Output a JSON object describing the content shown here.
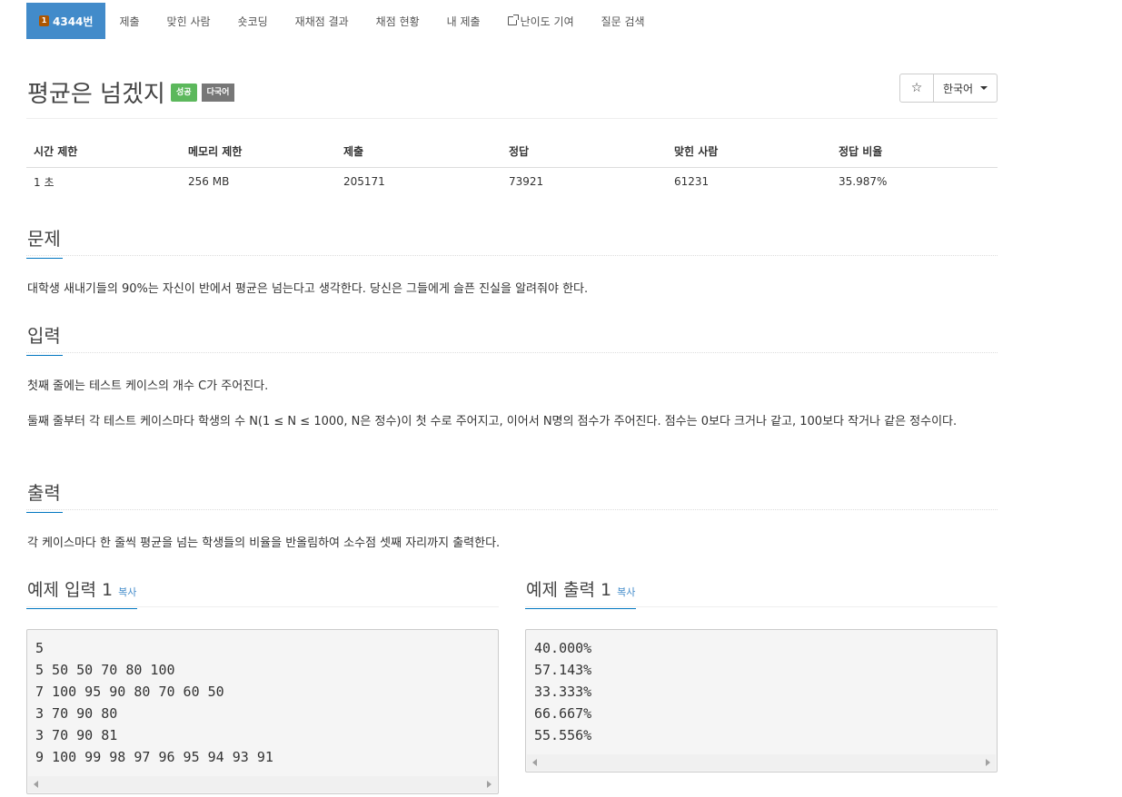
{
  "nav": {
    "problem_badge": "1",
    "problem_id": "4344번",
    "items": [
      "제출",
      "맞힌 사람",
      "숏코딩",
      "재채점 결과",
      "채점 현황",
      "내 제출"
    ],
    "external": "난이도 기여",
    "search": "질문 검색"
  },
  "title": "평균은 넘겠지",
  "badges": {
    "status": "성공",
    "lang": "다국어"
  },
  "language_select": "한국어",
  "info": {
    "headers": [
      "시간 제한",
      "메모리 제한",
      "제출",
      "정답",
      "맞힌 사람",
      "정답 비율"
    ],
    "values": [
      "1 초",
      "256 MB",
      "205171",
      "73921",
      "61231",
      "35.987%"
    ]
  },
  "sections": {
    "problem": {
      "heading": "문제",
      "text": "대학생 새내기들의 90%는 자신이 반에서 평균은 넘는다고 생각한다. 당신은 그들에게 슬픈 진실을 알려줘야 한다."
    },
    "input": {
      "heading": "입력",
      "p1": "첫째 줄에는 테스트 케이스의 개수 C가 주어진다.",
      "p2": "둘째 줄부터 각 테스트 케이스마다 학생의 수 N(1 ≤ N ≤ 1000, N은 정수)이 첫 수로 주어지고, 이어서 N명의 점수가 주어진다. 점수는 0보다 크거나 같고, 100보다 작거나 같은 정수이다."
    },
    "output": {
      "heading": "출력",
      "text": "각 케이스마다 한 줄씩 평균을 넘는 학생들의 비율을 반올림하여 소수점 셋째 자리까지 출력한다."
    }
  },
  "sample_input": {
    "heading": "예제 입력 1",
    "copy": "복사",
    "lines": [
      "5",
      "5 50 50 70 80 100",
      "7 100 95 90 80 70 60 50",
      "3 70 90 80",
      "3 70 90 81",
      "9 100 99 98 97 96 95 94 93 91"
    ]
  },
  "sample_output": {
    "heading": "예제 출력 1",
    "copy": "복사",
    "lines": [
      "40.000%",
      "57.143%",
      "33.333%",
      "66.667%",
      "55.556%"
    ]
  }
}
